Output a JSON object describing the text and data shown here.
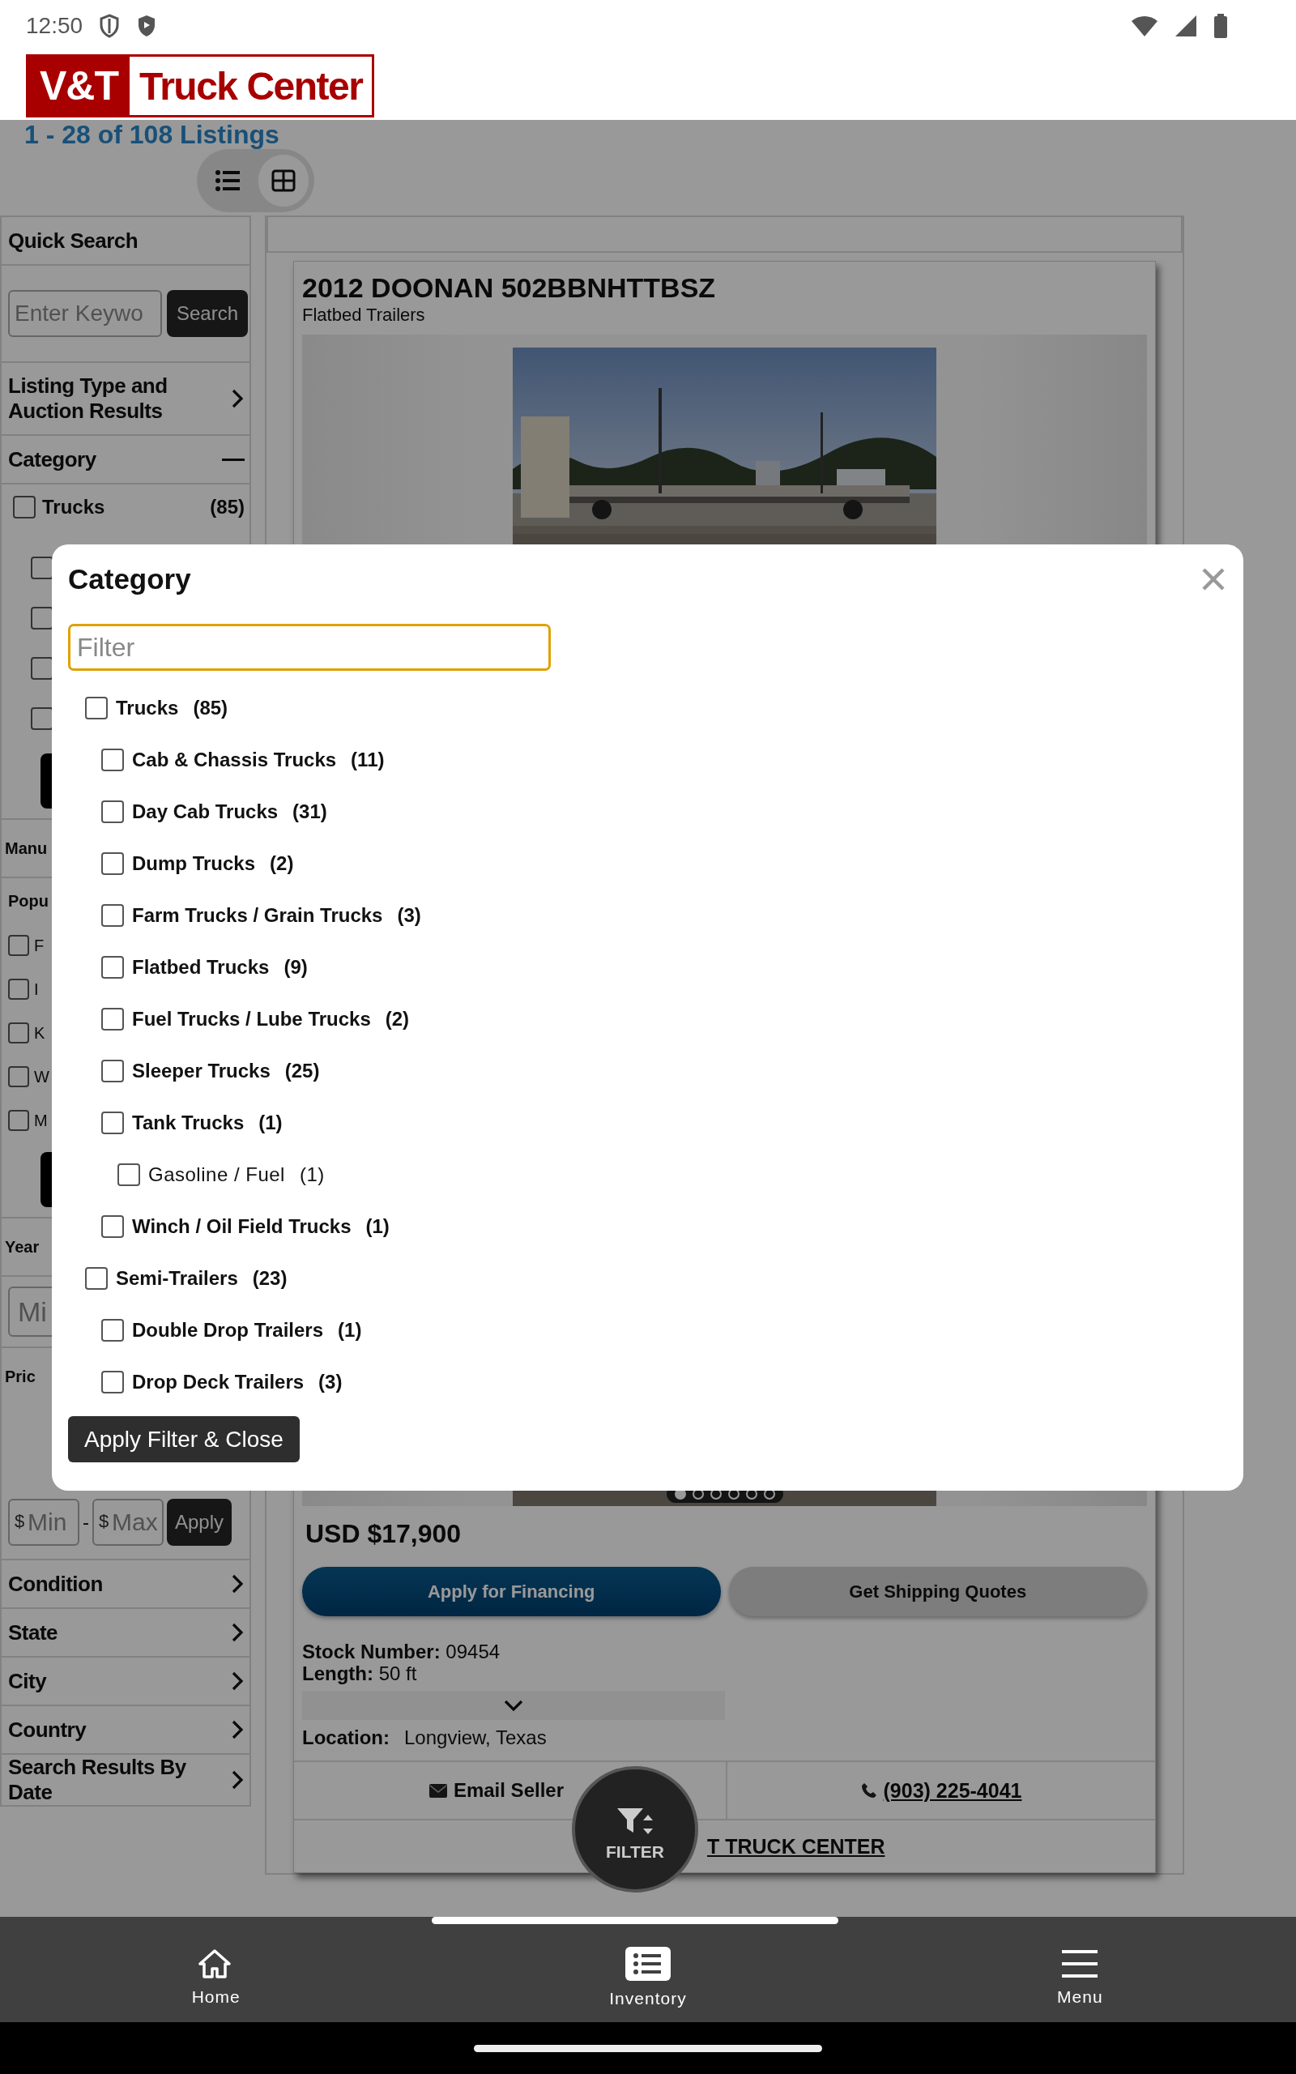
{
  "status_bar": {
    "time": "12:50"
  },
  "logo": {
    "left": "V&T",
    "right": "Truck Center"
  },
  "results_count": "1 - 28 of 108 Listings",
  "view_toggle": [
    {
      "kind": "list",
      "selected": false
    },
    {
      "kind": "grid",
      "selected": true
    }
  ],
  "sidebar": {
    "quick_search": {
      "title": "Quick Search",
      "placeholder": "Enter Keywo",
      "button": "Search"
    },
    "listing_type": {
      "title": "Listing Type and Auction Results",
      "expanded": false
    },
    "category": {
      "title": "Category",
      "expanded": true,
      "items": [
        {
          "label": "Trucks",
          "count": "(85)",
          "checked": false
        }
      ]
    },
    "fragments": [
      {
        "kind": "check",
        "checked": false
      },
      {
        "kind": "check",
        "checked": false
      },
      {
        "kind": "check",
        "checked": false
      },
      {
        "kind": "check",
        "checked": false
      },
      {
        "kind": "button"
      },
      {
        "kind": "heading",
        "text": "Manu"
      },
      {
        "kind": "subheading",
        "text": "Popu"
      },
      {
        "kind": "option",
        "text": "F",
        "checked": false
      },
      {
        "kind": "option",
        "text": "I",
        "checked": false
      },
      {
        "kind": "option",
        "text": "K",
        "checked": false
      },
      {
        "kind": "option",
        "text": "W",
        "checked": false
      },
      {
        "kind": "option",
        "text": "M",
        "checked": false
      },
      {
        "kind": "button"
      },
      {
        "kind": "heading",
        "text": "Year"
      },
      {
        "kind": "field",
        "placeholder": "Mi"
      },
      {
        "kind": "heading",
        "text": "Pric"
      }
    ],
    "price": {
      "currency": "$",
      "min_placeholder": "Min",
      "separator": "-",
      "max_placeholder": "Max",
      "button": "Apply"
    },
    "sections": [
      {
        "title": "Condition",
        "expanded": false
      },
      {
        "title": "State",
        "expanded": false
      },
      {
        "title": "City",
        "expanded": false
      },
      {
        "title": "Country",
        "expanded": false
      },
      {
        "title": "Search Results By Date",
        "expanded": false
      }
    ]
  },
  "listing": {
    "title": "2012 DOONAN 502BBNHTTBSZ",
    "subtitle": "Flatbed Trailers",
    "pager": [
      {
        "selected": true
      },
      {
        "selected": false
      },
      {
        "selected": false
      },
      {
        "selected": false
      },
      {
        "selected": false
      },
      {
        "selected": false
      }
    ],
    "price": "USD $17,900",
    "buttons": [
      {
        "label": "Apply for Financing",
        "kind": "primary"
      },
      {
        "label": "Get Shipping Quotes",
        "kind": "secondary"
      }
    ],
    "specs": [
      {
        "label": "Stock Number:",
        "value": "09454"
      },
      {
        "label": "Length:",
        "value": "50 ft"
      }
    ],
    "location": {
      "label": "Location:",
      "value": "Longview, Texas"
    },
    "email": "Email Seller",
    "phone": "(903) 225-4041",
    "dealer_link": "T TRUCK CENTER"
  },
  "modal": {
    "title": "Category",
    "filter_placeholder": "Filter",
    "apply_button": "Apply Filter & Close",
    "tree": [
      {
        "label": "Trucks",
        "count": "(85)",
        "checked": false,
        "children": [
          {
            "label": "Cab & Chassis Trucks",
            "count": "(11)",
            "checked": false
          },
          {
            "label": "Day Cab Trucks",
            "count": "(31)",
            "checked": false
          },
          {
            "label": "Dump Trucks",
            "count": "(2)",
            "checked": false
          },
          {
            "label": "Farm Trucks / Grain Trucks",
            "count": "(3)",
            "checked": false
          },
          {
            "label": "Flatbed Trucks",
            "count": "(9)",
            "checked": false
          },
          {
            "label": "Fuel Trucks / Lube Trucks",
            "count": "(2)",
            "checked": false
          },
          {
            "label": "Sleeper Trucks",
            "count": "(25)",
            "checked": false
          },
          {
            "label": "Tank Trucks",
            "count": "(1)",
            "checked": false,
            "children": [
              {
                "label": "Gasoline / Fuel",
                "count": "(1)",
                "checked": false
              }
            ]
          },
          {
            "label": "Winch / Oil Field Trucks",
            "count": "(1)",
            "checked": false
          }
        ]
      },
      {
        "label": "Semi-Trailers",
        "count": "(23)",
        "checked": false,
        "children": [
          {
            "label": "Double Drop Trailers",
            "count": "(1)",
            "checked": false
          },
          {
            "label": "Drop Deck Trailers",
            "count": "(3)",
            "checked": false
          }
        ]
      }
    ]
  },
  "fab": {
    "label": "FILTER"
  },
  "bottom_nav": [
    {
      "label": "Home",
      "kind": "home"
    },
    {
      "label": "Inventory",
      "kind": "inventory"
    },
    {
      "label": "Menu",
      "kind": "menu"
    }
  ]
}
